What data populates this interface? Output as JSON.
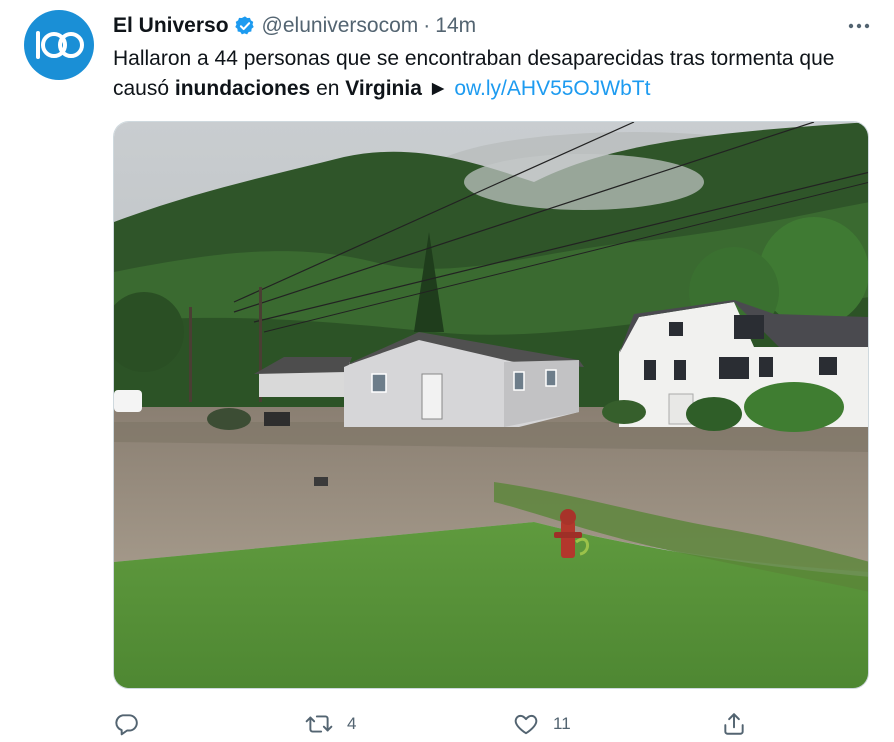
{
  "tweet": {
    "author_name": "El Universo",
    "author_handle": "@eluniversocom",
    "separator": "·",
    "time": "14m",
    "avatar_text": "100",
    "text_part1": "Hallaron a 44 personas que se encontraban desaparecidas tras tormenta que causó ",
    "bold1": "inundaciones",
    "text_part2": " en ",
    "bold2": "Virginia",
    "text_part3": " ► ",
    "link": "ow.ly/AHV55OJWbTt"
  },
  "media": {
    "description_icon": "flood-photo"
  },
  "actions": {
    "reply_count": "",
    "retweet_count": "4",
    "like_count": "11"
  },
  "colors": {
    "avatar_bg": "#1a8fd6",
    "link": "#1d9bf0",
    "verified": "#1d9bf0",
    "muted": "#536471"
  }
}
